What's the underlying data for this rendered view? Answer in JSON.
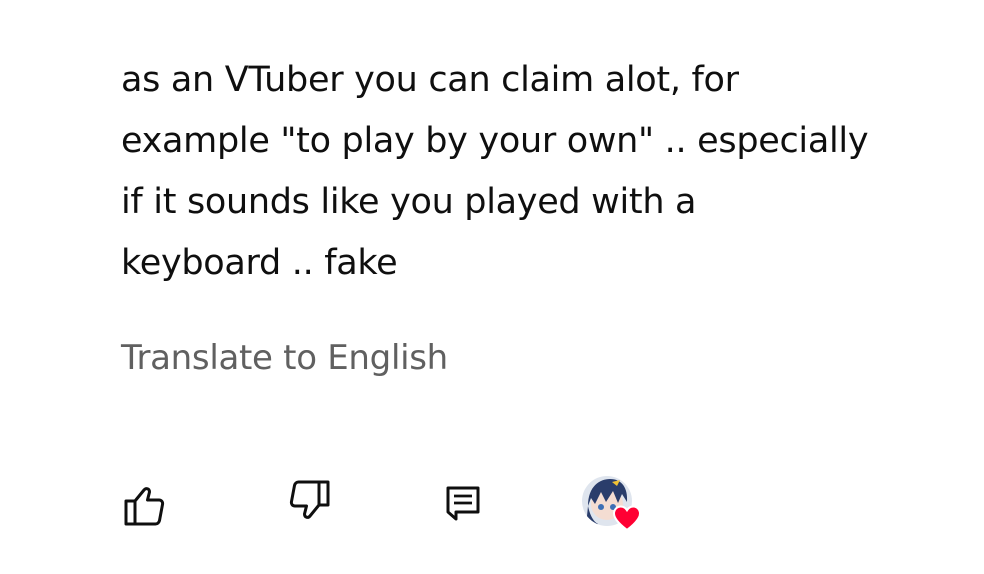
{
  "comment": {
    "lines": [
      "as an VTuber you can claim alot, for",
      "example \"to play by your own\" .. especially",
      "if it sounds like you played with a",
      "keyboard .. fake"
    ]
  },
  "translate": {
    "label": "Translate to English"
  },
  "actions": {
    "like_icon": "thumbs-up-icon",
    "dislike_icon": "thumbs-down-icon",
    "reply_icon": "comment-icon",
    "creator_heart_icon": "heart-icon"
  },
  "colors": {
    "text": "#0f0f0f",
    "secondary_text": "#606060",
    "heart": "#ff0033",
    "icon": "#0f0f0f"
  }
}
